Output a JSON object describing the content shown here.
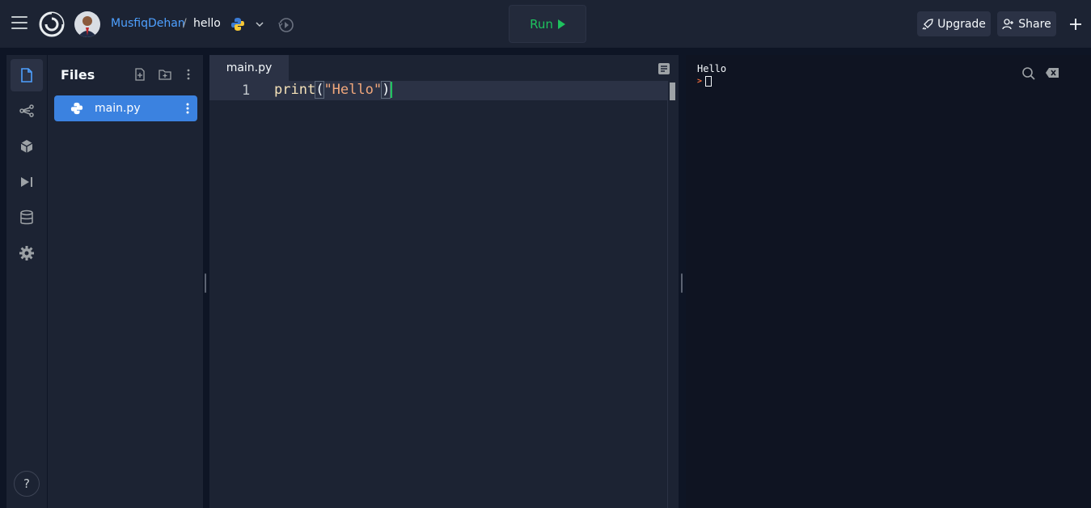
{
  "header": {
    "user": "MusfiqDehan",
    "separator": "/",
    "repl": "hello",
    "run_label": "Run",
    "upgrade_label": "Upgrade",
    "share_label": "Share"
  },
  "files_panel": {
    "title": "Files",
    "items": [
      {
        "name": "main.py",
        "selected": true
      }
    ]
  },
  "editor": {
    "tab": "main.py",
    "lines": [
      {
        "number": "1",
        "tokens": {
          "fn": "print",
          "open": "(",
          "str": "\"Hello\"",
          "close": ")"
        }
      }
    ]
  },
  "console": {
    "output": "Hello",
    "prompt": ">"
  },
  "help_label": "?",
  "colors": {
    "accent_blue": "#3b82e0",
    "run_green": "#1ec25e",
    "background": "#0e1525",
    "panel": "#1c2333"
  }
}
